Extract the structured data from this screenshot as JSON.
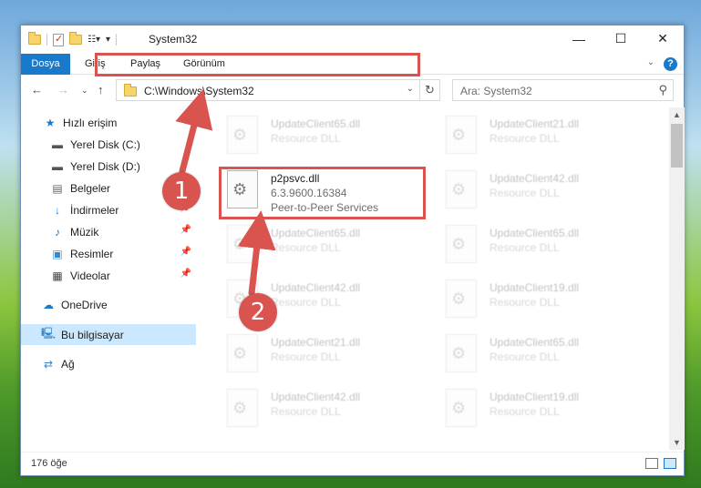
{
  "window": {
    "title": "System32",
    "controls": {
      "minimize": "—",
      "maximize": "☐",
      "close": "✕"
    }
  },
  "ribbon": {
    "tabs": [
      "Dosya",
      "Giriş",
      "Paylaş",
      "Görünüm"
    ],
    "help": "?"
  },
  "navigation": {
    "address": "C:\\Windows\\System32",
    "search_placeholder": "Ara: System32"
  },
  "sidebar": {
    "items": [
      {
        "label": "Hızlı erişim",
        "icon": "star-icon"
      },
      {
        "label": "Yerel Disk (C:)",
        "icon": "drive-icon"
      },
      {
        "label": "Yerel Disk (D:)",
        "icon": "drive-icon"
      },
      {
        "label": "Belgeler",
        "icon": "documents-icon"
      },
      {
        "label": "İndirmeler",
        "icon": "download-icon"
      },
      {
        "label": "Müzik",
        "icon": "music-icon"
      },
      {
        "label": "Resimler",
        "icon": "pictures-icon"
      },
      {
        "label": "Videolar",
        "icon": "video-icon"
      },
      {
        "label": "OneDrive",
        "icon": "cloud-icon"
      },
      {
        "label": "Bu bilgisayar",
        "icon": "computer-icon"
      },
      {
        "label": "Ağ",
        "icon": "network-icon"
      }
    ]
  },
  "files": {
    "highlighted": {
      "name": "p2psvc.dll",
      "version": "6.3.9600.16384",
      "description": "Peer-to-Peer Services"
    },
    "background": [
      {
        "name": "UpdateClient65.dll",
        "type": "Resource DLL"
      },
      {
        "name": "UpdateClient21.dll",
        "type": "Resource DLL"
      },
      {
        "name": "UpdateClient42.dll",
        "type": "Resource DLL"
      },
      {
        "name": "UpdateClient65.dll",
        "type": "Resource DLL"
      },
      {
        "name": "UpdateClient65.dll",
        "type": "Resource DLL"
      },
      {
        "name": "UpdateClient42.dll",
        "type": "Resource DLL"
      },
      {
        "name": "UpdateClient19.dll",
        "type": "Resource DLL"
      },
      {
        "name": "UpdateClient21.dll",
        "type": "Resource DLL"
      },
      {
        "name": "UpdateClient65.dll",
        "type": "Resource DLL"
      },
      {
        "name": "UpdateClient42.dll",
        "type": "Resource DLL"
      },
      {
        "name": "UpdateClient19.dll",
        "type": "Resource DLL"
      }
    ]
  },
  "status": {
    "count": "176 öğe"
  },
  "annotations": {
    "step1": "1",
    "step2": "2",
    "color": "#d9534f"
  }
}
